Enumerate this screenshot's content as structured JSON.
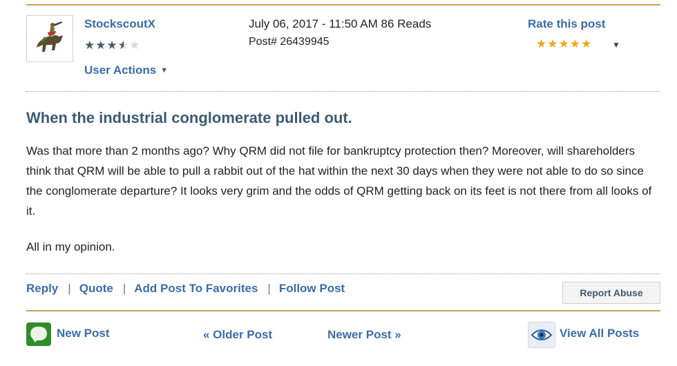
{
  "author": {
    "username": "StockscoutX",
    "rating_stars_filled": 3.5,
    "rating_stars_total": 5,
    "stars_display_on": "★★★",
    "stars_display_half": "★",
    "stars_display_off": "★",
    "user_actions_label": "User Actions",
    "avatar_icon": "knight-on-horse-icon"
  },
  "meta": {
    "date_reads": "July 06, 2017 - 11:50 AM 86 Reads",
    "post_number": "Post# 26439945"
  },
  "rating": {
    "label": "Rate this post",
    "stars_display": "★★★★★",
    "stars_value": 5
  },
  "post": {
    "title": "When the industrial conglomerate pulled out.",
    "body": "Was that more than 2 months ago? Why QRM did not file for bankruptcy protection then? Moreover, will shareholders think that QRM will be able to pull a rabbit out of the hat within the next 30 days when they were not able to do so since the conglomerate departure? It looks very grim and the odds of QRM getting back on its feet is not there from all looks of it.",
    "signature": "All in my opinion."
  },
  "actions": {
    "reply": "Reply",
    "quote": "Quote",
    "favorites": "Add Post To Favorites",
    "follow": "Follow Post",
    "separator": "|",
    "report_abuse": "Report Abuse"
  },
  "nav": {
    "new_post": "New Post",
    "older_post": "« Older Post",
    "newer_post": "Newer Post »",
    "view_all": "View All Posts"
  },
  "colors": {
    "link": "#3a6cab",
    "title": "#3d5a73",
    "gold_rule": "#c8a25a",
    "star_rate": "#f0a81a",
    "new_post_green": "#2e8c2a"
  }
}
